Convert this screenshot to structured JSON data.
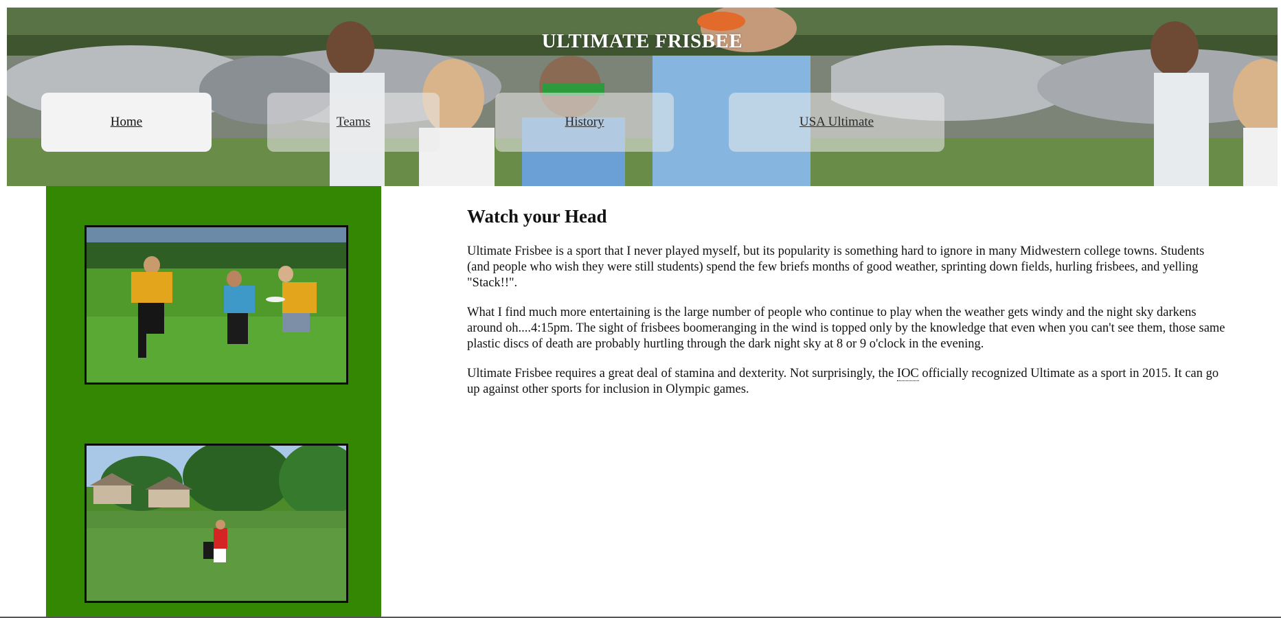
{
  "header": {
    "title": "ULTIMATE FRISBEE",
    "nav": [
      {
        "label": "Home",
        "active": true
      },
      {
        "label": "Teams",
        "active": false
      },
      {
        "label": "History",
        "active": false
      },
      {
        "label": "USA Ultimate",
        "active": false
      }
    ]
  },
  "main": {
    "heading": "Watch your Head",
    "p1": "Ultimate Frisbee is a sport that I never played myself, but its popularity is something hard to ignore in many Midwestern college towns. Students (and people who wish they were still students) spend the few briefs months of good weather, sprinting down fields, hurling frisbees, and yelling \"Stack!!\".",
    "p2": "What I find much more entertaining is the large number of people who continue to play when the weather gets windy and the night sky darkens around oh....4:15pm. The sight of frisbees boomeranging in the wind is topped only by the knowledge that even when you can't see them, those same plastic discs of death are probably hurtling through the dark night sky at 8 or 9 o'clock in the evening.",
    "p3_before": "Ultimate Frisbee requires a great deal of stamina and dexterity. Not surprisingly, the ",
    "p3_abbr": "IOC",
    "p3_after": " officially recognized Ultimate as a sport in 2015. It can go up against other sports for inclusion in Olympic games."
  },
  "colors": {
    "sidebar": "#348703",
    "nav_bg": "#f3f3f3",
    "title_text": "#ffffff"
  }
}
